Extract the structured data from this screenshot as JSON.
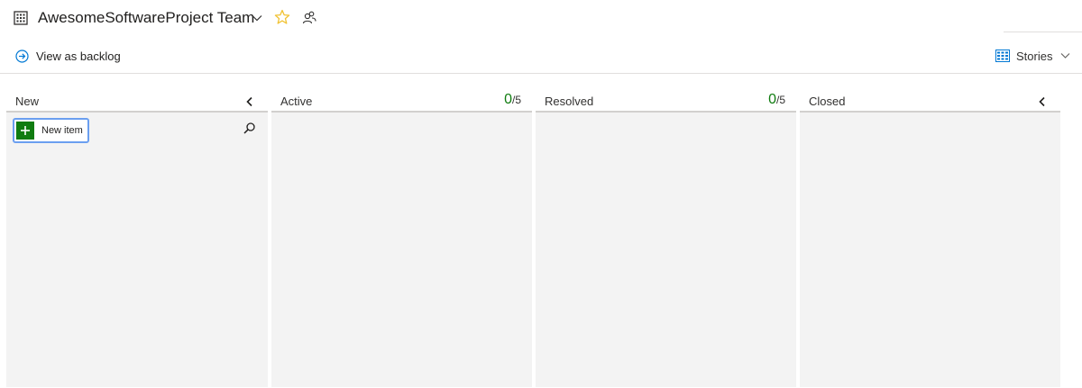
{
  "header": {
    "team_name": "AwesomeSoftwareProject Team",
    "team_icon": "board-grid-icon",
    "favorite_icon": "star-icon",
    "favorite_color": "#f1c232",
    "members_icon": "team-members-icon"
  },
  "toolbar": {
    "backlog_label": "View as backlog",
    "backlog_icon": "arrow-circle-right-icon",
    "backlog_icon_color": "#0078d4",
    "backlog_level": "Stories",
    "backlog_level_icon": "backlog-level-icon"
  },
  "board": {
    "columns": [
      {
        "title": "New",
        "count": "",
        "limit": "",
        "collapsible": true
      },
      {
        "title": "Active",
        "count": "0",
        "limit": "/5",
        "collapsible": false
      },
      {
        "title": "Resolved",
        "count": "0",
        "limit": "/5",
        "collapsible": false
      },
      {
        "title": "Closed",
        "count": "",
        "limit": "",
        "collapsible": true
      }
    ],
    "new_item_label": "New item",
    "accent_green": "#107c10",
    "column_background": "#f3f3f3"
  }
}
